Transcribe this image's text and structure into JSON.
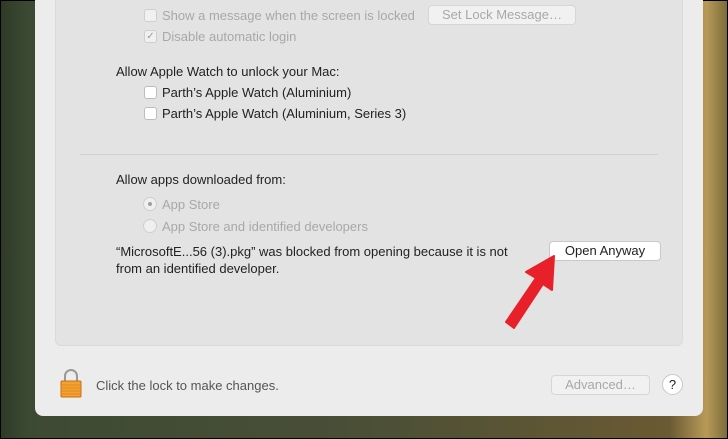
{
  "lock_section": {
    "show_message_label": "Show a message when the screen is locked",
    "set_lock_message_button": "Set Lock Message…",
    "disable_login_label": "Disable automatic login",
    "disable_login_checked": true
  },
  "watch_section": {
    "heading": "Allow Apple Watch to unlock your Mac:",
    "watches": [
      {
        "label": "Parth’s Apple Watch (Aluminium)",
        "checked": false
      },
      {
        "label": "Parth’s Apple Watch (Aluminium, Series 3)",
        "checked": false
      }
    ]
  },
  "downloads": {
    "heading": "Allow apps downloaded from:",
    "options": [
      {
        "label": "App Store",
        "selected": true
      },
      {
        "label": "App Store and identified developers",
        "selected": false
      }
    ],
    "blocked_line1": "“MicrosoftE...56 (3).pkg” was blocked from opening because it is not",
    "blocked_line2": "from an identified developer.",
    "open_anyway_button": "Open Anyway"
  },
  "footer": {
    "lock_text": "Click the lock to make changes.",
    "advanced_button": "Advanced…",
    "help_button": "?"
  },
  "colors": {
    "arrow": "#e8202a",
    "lock": "#f5a030"
  }
}
